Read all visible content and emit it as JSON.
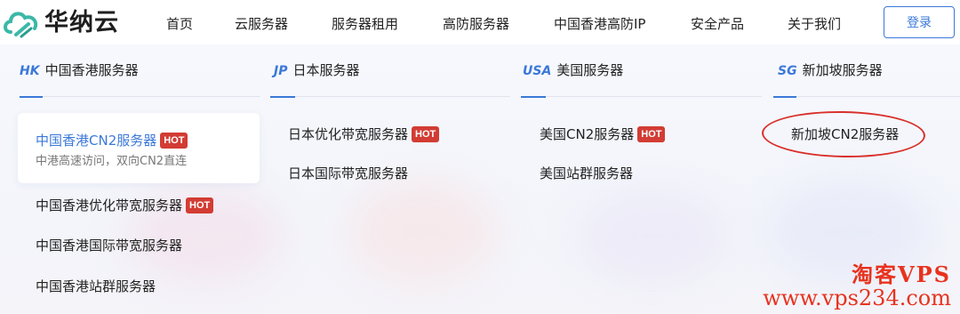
{
  "brand": {
    "logo_text": "华纳云"
  },
  "nav": {
    "items": [
      "首页",
      "云服务器",
      "服务器租用",
      "高防服务器",
      "中国香港高防IP",
      "安全产品",
      "关于我们"
    ],
    "login": "登录"
  },
  "columns": [
    {
      "code": "HK",
      "title": "中国香港服务器",
      "items": [
        {
          "label": "中国香港CN2服务器",
          "hot": "HOT",
          "sub": "中港高速访问，双向CN2直连"
        },
        {
          "label": "中国香港优化带宽服务器",
          "hot": "HOT"
        },
        {
          "label": "中国香港国际带宽服务器"
        },
        {
          "label": "中国香港站群服务器"
        }
      ]
    },
    {
      "code": "JP",
      "title": "日本服务器",
      "items": [
        {
          "label": "日本优化带宽服务器",
          "hot": "HOT"
        },
        {
          "label": "日本国际带宽服务器"
        }
      ]
    },
    {
      "code": "USA",
      "title": "美国服务器",
      "items": [
        {
          "label": "美国CN2服务器",
          "hot": "HOT"
        },
        {
          "label": "美国站群服务器"
        }
      ]
    },
    {
      "code": "SG",
      "title": "新加坡服务器",
      "items": [
        {
          "label": "新加坡CN2服务器"
        }
      ]
    }
  ],
  "watermark": {
    "line1": "淘客VPS",
    "line2": "www.vps234.com"
  },
  "colors": {
    "accent": "#3b78d8",
    "hot": "#d23c34",
    "annotation": "#d9302b",
    "watermark": "#e8321e"
  }
}
